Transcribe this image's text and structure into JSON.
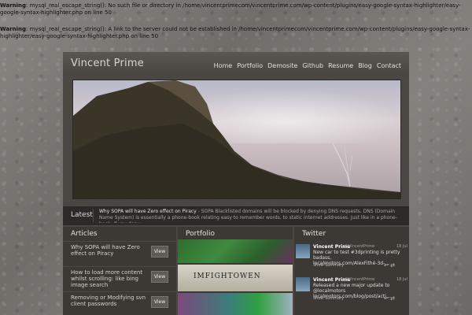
{
  "warnings": [
    {
      "label": "Warning",
      "text": ": mysql_real_escape_string(): No such file or directory in /home/vincentprimecom/vincentprime.com/wp-content/plugins/easy-google-syntax-highlighter/easy-google-syntax-highlighter.php on line 50"
    },
    {
      "label": "Warning",
      "text": ": mysql_real_escape_string(): A link to the server could not be established in /home/vincentprimecom/vincentprime.com/wp-content/plugins/easy-google-syntax-highlighter/easy-google-syntax-highlighter.php on line 50"
    }
  ],
  "site": {
    "title": "Vincent Prime"
  },
  "nav": [
    "Home",
    "Portfolio",
    "Demosite",
    "Github",
    "Resume",
    "Blog",
    "Contact"
  ],
  "latest": {
    "label": "Latest",
    "title": "Why SOPA will have Zero effect on Piracy",
    "excerpt": " - SOPA Blacklisted domains will be blocked by denying DNS requests. DNS (Domain Name System) is essentially a phone-book relating easy to remember words, to static internet addresses. Just like in a phone-book, if you deny"
  },
  "articles": {
    "heading": "Articles",
    "items": [
      {
        "title": "Why SOPA will have Zero effect on Piracy",
        "button": "View"
      },
      {
        "title": "How to load more content whilst scrolling: like bing image search",
        "button": "View"
      },
      {
        "title": "Removing or Modifying svn client passwords",
        "button": "View"
      }
    ]
  },
  "portfolio": {
    "heading": "Portfolio",
    "banner": "IMFIGHTOWEN"
  },
  "twitter": {
    "heading": "Twitter",
    "tweets": [
      {
        "name": "Vincent Prime",
        "handle": "@VincentPrime",
        "date": "18 Jul",
        "text": "New car to test #3dprinting is pretty badass, localmotors.com/AlexFithé-3d-...",
        "summary": "Show Summary"
      },
      {
        "name": "Vincent Prime",
        "handle": "@VincentPrime",
        "date": "18 Jul",
        "text": "Released a new major update to @localmotors localmotors.com/blog/post/acti...",
        "summary": "Show Summary"
      }
    ]
  }
}
